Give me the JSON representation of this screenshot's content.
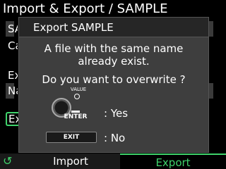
{
  "screen": {
    "title": "Import & Export / SAMPLE",
    "bg_rows": [
      "SA",
      "Ca",
      "Ex",
      "Na"
    ],
    "exec_label": "Ex"
  },
  "dialog": {
    "title": "Export SAMPLE",
    "message_line_1": "A file with the same name",
    "message_line_2": "already exist.",
    "question": "Do you want to overwrite ?",
    "value_label": "VALUE",
    "enter_label": "ENTER",
    "yes_label": ": Yes",
    "exit_label": "EXIT",
    "no_label": ": No"
  },
  "tabs": {
    "refresh_icon": "refresh-icon",
    "import_label": "Import",
    "export_label": "Export",
    "active": "Export"
  },
  "colors": {
    "accent": "#3fd26b",
    "dialog_bg": "#3e3e3e",
    "title_bar": "#262626"
  }
}
